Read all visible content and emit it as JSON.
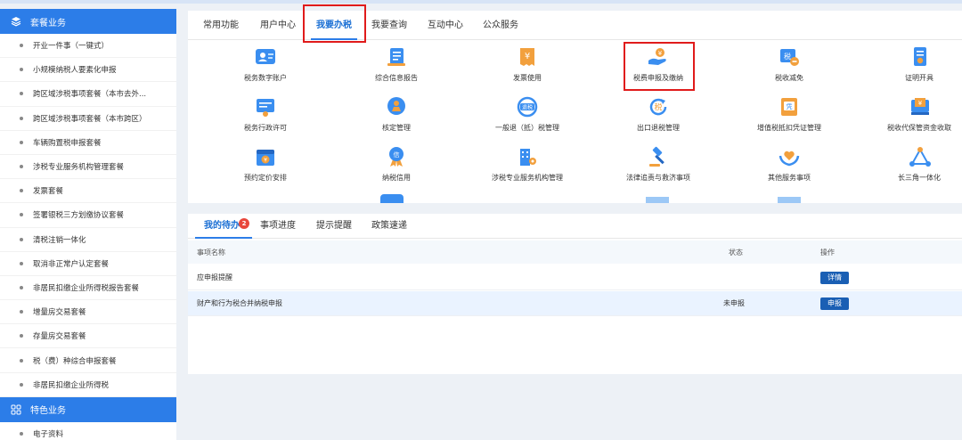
{
  "sidebar": {
    "group1": {
      "label": "套餐业务"
    },
    "items": [
      {
        "label": "开业一件事（一键式）"
      },
      {
        "label": "小规模纳税人要素化申报"
      },
      {
        "label": "跨区域涉税事项套餐（本市去外..."
      },
      {
        "label": "跨区域涉税事项套餐（本市跨区）"
      },
      {
        "label": "车辆购置税申报套餐"
      },
      {
        "label": "涉税专业服务机构管理套餐"
      },
      {
        "label": "发票套餐"
      },
      {
        "label": "签署银税三方划缴协议套餐"
      },
      {
        "label": "清税注销一体化"
      },
      {
        "label": "取消非正常户认定套餐"
      },
      {
        "label": "非居民扣缴企业所得税报告套餐"
      },
      {
        "label": "增量房交易套餐"
      },
      {
        "label": "存量房交易套餐"
      },
      {
        "label": "税（费）种综合申报套餐"
      },
      {
        "label": "非居民扣缴企业所得税"
      }
    ],
    "group2": {
      "label": "特色业务"
    },
    "items2": [
      {
        "label": "电子资料"
      }
    ]
  },
  "top_tabs": [
    {
      "label": "常用功能"
    },
    {
      "label": "用户中心"
    },
    {
      "label": "我要办税"
    },
    {
      "label": "我要查询"
    },
    {
      "label": "互动中心"
    },
    {
      "label": "公众服务"
    }
  ],
  "services": [
    {
      "label": "税务数字账户",
      "icon": "digital-account-icon"
    },
    {
      "label": "综合信息报告",
      "icon": "report-icon"
    },
    {
      "label": "发票使用",
      "icon": "invoice-icon"
    },
    {
      "label": "税费申报及缴纳",
      "icon": "tax-payment-icon"
    },
    {
      "label": "税收减免",
      "icon": "tax-relief-icon"
    },
    {
      "label": "证明开具",
      "icon": "certificate-icon"
    },
    {
      "label": "税务行政许可",
      "icon": "license-icon"
    },
    {
      "label": "核定管理",
      "icon": "verification-icon"
    },
    {
      "label": "一般退（抵）税管理",
      "icon": "refund-icon"
    },
    {
      "label": "出口退税管理",
      "icon": "export-refund-icon"
    },
    {
      "label": "增值税抵扣凭证管理",
      "icon": "vat-voucher-icon"
    },
    {
      "label": "税收代保管资金收取",
      "icon": "custody-fund-icon"
    },
    {
      "label": "预约定价安排",
      "icon": "calendar-icon"
    },
    {
      "label": "纳税信用",
      "icon": "credit-medal-icon"
    },
    {
      "label": "涉税专业服务机构管理",
      "icon": "agency-icon"
    },
    {
      "label": "法律追责与救济事项",
      "icon": "gavel-icon"
    },
    {
      "label": "其他服务事项",
      "icon": "heart-hands-icon"
    },
    {
      "label": "长三角一体化",
      "icon": "triangle-network-icon"
    }
  ],
  "bottom_tabs": [
    {
      "label": "我的待办",
      "badge": "2"
    },
    {
      "label": "事项进度"
    },
    {
      "label": "提示提醒"
    },
    {
      "label": "政策速递"
    }
  ],
  "table": {
    "headers": {
      "name": "事项名称",
      "status": "状态",
      "action": "操作"
    },
    "rows": [
      {
        "name": "应申报提醒",
        "status": "",
        "action": "详情"
      },
      {
        "name": "财产和行为税合并纳税申报",
        "status": "未申报",
        "action": "申报"
      }
    ]
  },
  "colors": {
    "primary": "#2c7de8",
    "highlight": "#e01b1b",
    "button": "#1a5fb4"
  }
}
